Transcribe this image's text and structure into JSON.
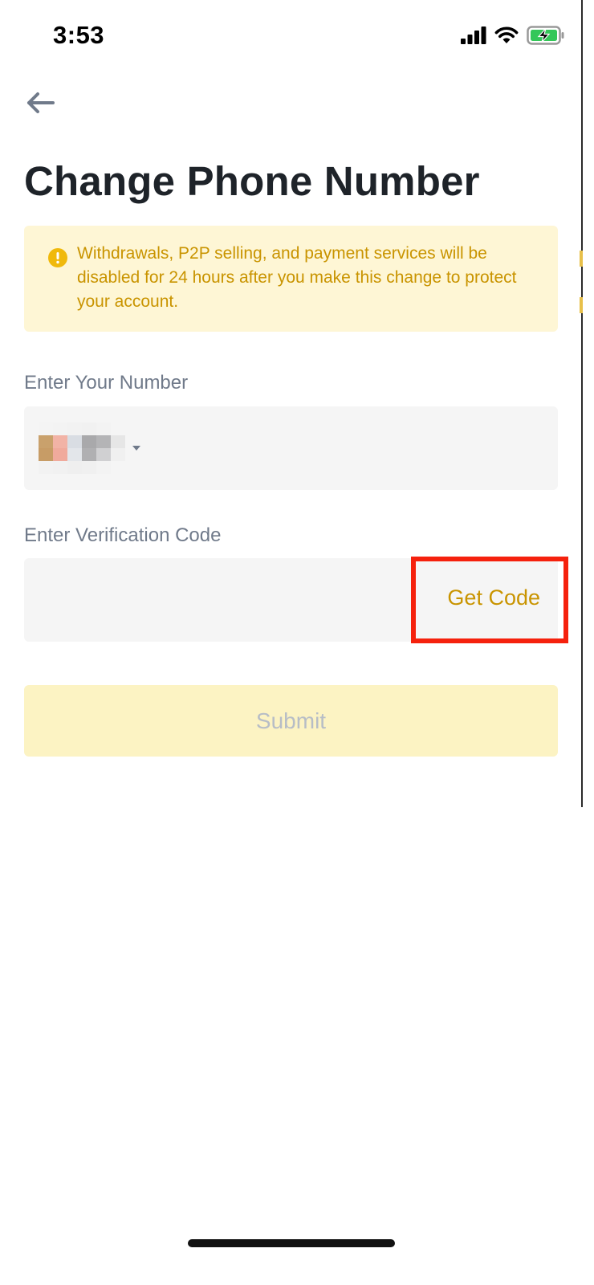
{
  "status_bar": {
    "time": "3:53",
    "icons": [
      "cellular-signal-icon",
      "wifi-icon",
      "battery-charging-icon"
    ],
    "battery_color": "#34c759"
  },
  "nav": {
    "back_icon": "back-arrow-icon"
  },
  "page": {
    "title": "Change Phone Number"
  },
  "warning": {
    "icon": "exclamation-circle-icon",
    "text": "Withdrawals, P2P selling, and payment services will be disabled for 24 hours after you make this change to protect your account.",
    "background": "#fef6d5",
    "text_color": "#c99400"
  },
  "phone_field": {
    "label": "Enter Your Number",
    "country_code": "",
    "dropdown_icon": "caret-down-icon"
  },
  "verification_field": {
    "label": "Enter Verification Code",
    "value": "",
    "placeholder": "",
    "get_code_label": "Get Code"
  },
  "submit": {
    "label": "Submit",
    "background": "#fcf3c3",
    "text_color": "#b7bdc6"
  },
  "colors": {
    "accent": "#c99400",
    "title": "#1e2329",
    "label": "#707a8a",
    "input_bg": "#f5f5f5",
    "highlight": "#f5210d"
  }
}
